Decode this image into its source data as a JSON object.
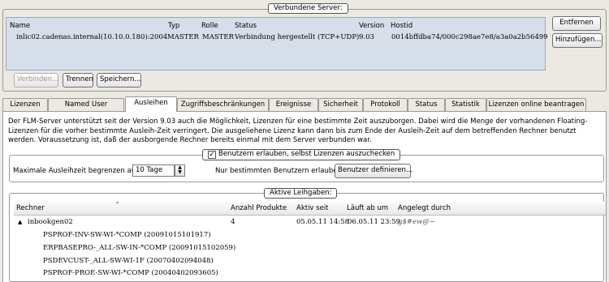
{
  "servers": {
    "legend": "Verbundene Server:",
    "columns": [
      "Name",
      "Typ",
      "Rolle",
      "Status",
      "Version",
      "Hostid"
    ],
    "row": {
      "name": "inlic02.cadenas.internal(10.10.0.180):2004",
      "typ": "MASTER",
      "rolle": "MASTER",
      "status": "Verbindung hergestellt (TCP+UDP)",
      "version": "9.03",
      "hostid": "0014bffdba74/000c298ae7e8/a3a0a2b56499"
    },
    "buttons": {
      "entfernen": "Entfernen",
      "hinzufuegen": "Hinzufügen...",
      "verbinden": "Verbinden...",
      "trennen": "Trennen",
      "speichern": "Speichern..."
    }
  },
  "tabs": [
    "Lizenzen",
    "Named User",
    "Ausleihen",
    "Zugriffsbeschränkungen",
    "Ereignisse",
    "Sicherheit",
    "Protokoll",
    "Status",
    "Statistik",
    "Lizenzen online beantragen"
  ],
  "active_tab": "Ausleihen",
  "description": "Der FLM-Server unterstützt seit der Version 9.03 auch die Möglichkeit, Lizenzen für eine bestimmte Zeit auszuborgen. Dabei wird die Menge der vorhandenen Floating-Lizenzen für die vorher bestimmte Ausleih-Zeit verringert. Die ausgeliehene Lizenz kann dann bis zum Ende der Ausleih-Zeit auf dem betreffenden Rechner benutzt werden. Voraussetzung ist, daß der ausborgende Rechner bereits einmal mit dem Server verbunden war.",
  "allow_checkout": {
    "label": "Benutzern erlauben, selbst Lizenzen auszuchecken",
    "checked": true,
    "check_glyph": "✓",
    "max_time_label": "Maximale Ausleihzeit begrenzen auf:",
    "max_time_value": "10 Tage",
    "only_users_label": "Nur bestimmten Benutzern erlauben:",
    "define_users_button": "Benutzer definieren..."
  },
  "active_loans": {
    "legend": "Aktive Leihgaben:",
    "columns": [
      "Rechner",
      "Anzahl Produkte",
      "Aktiv seit",
      "Läuft ab um",
      "Angelegt durch"
    ],
    "machine": {
      "name": "inbookgen02",
      "count": "4",
      "since": "05.05.11 14:58",
      "expires": "06.05.11 23:59",
      "created_by": "g$#ew@~"
    },
    "products": [
      "PSPROF-INV-SW-WI-*COMP (20091015101917)",
      "ERPBASEPRO-_ALL-SW-IN-*COMP (20091015102059)",
      "PSDEVCUST-_ALL-SW-WI-1F (20070402094048)",
      "PSPROF-PROE-SW-WI-*COMP (20040402093605)"
    ]
  }
}
